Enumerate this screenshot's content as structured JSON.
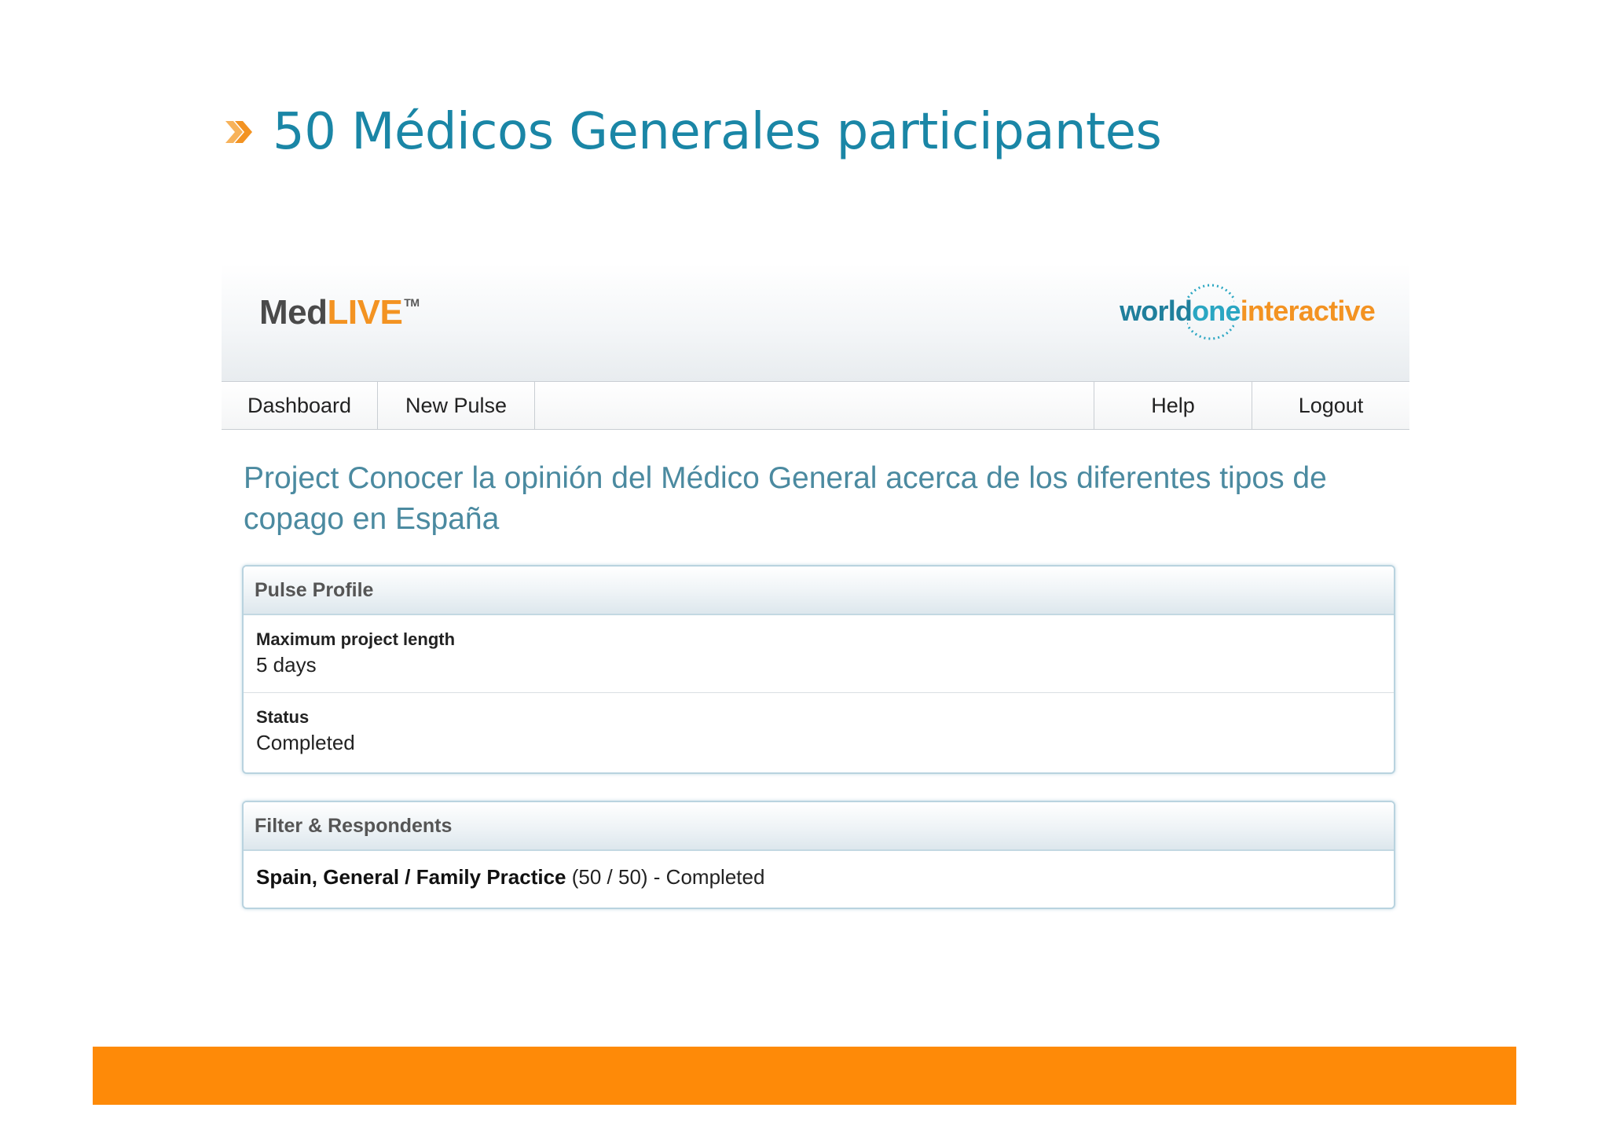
{
  "slide": {
    "title": "50 Médicos Generales participantes",
    "bullet_icon": "double-chevron-icon",
    "accent_color": "#f39322",
    "bar_color": "#fe8a08"
  },
  "app": {
    "logo_left": {
      "part1": "Med",
      "part2": "LIVE",
      "tm": "TM"
    },
    "logo_right": {
      "part1": "world",
      "part2": "one",
      "part3": "interactive"
    },
    "nav": {
      "dashboard": "Dashboard",
      "new_pulse": "New Pulse",
      "help": "Help",
      "logout": "Logout"
    },
    "project_title": "Project Conocer la opinión del Médico General acerca de los diferentes tipos de copago en España",
    "pulse_profile": {
      "header": "Pulse Profile",
      "max_length_label": "Maximum project length",
      "max_length_value": "5 days",
      "status_label": "Status",
      "status_value": "Completed"
    },
    "filter": {
      "header": "Filter & Respondents",
      "segment": "Spain, General / Family Practice",
      "count": "(50 / 50) - Completed"
    }
  }
}
